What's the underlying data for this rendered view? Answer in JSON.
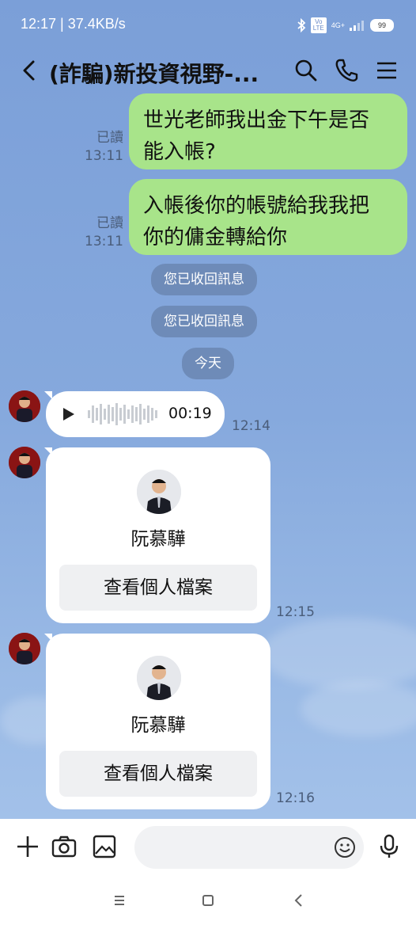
{
  "status": {
    "time_speed": "12:17 | 37.4KB/s",
    "volte": "Vo LTE",
    "network": "4G+",
    "battery": "99"
  },
  "header": {
    "title": "(詐騙)新投資視野-...",
    "back_icon": "back-arrow-icon",
    "search_icon": "search-icon",
    "call_icon": "phone-icon",
    "menu_icon": "menu-icon"
  },
  "messages": [
    {
      "type": "outgoing",
      "text_line1": "世光老師我出金下午是否",
      "text_line2": "能入帳?",
      "read": "已讀",
      "time": "13:11"
    },
    {
      "type": "outgoing",
      "text_line1": "入帳後你的帳號給我我把",
      "text_line2": "你的傭金轉給你",
      "read": "已讀",
      "time": "13:11"
    }
  ],
  "system": {
    "recalled1": "您已收回訊息",
    "recalled2": "您已收回訊息",
    "date": "今天"
  },
  "voice": {
    "duration": "00:19",
    "time": "12:14"
  },
  "cards": [
    {
      "name": "阮慕驊",
      "button": "查看個人檔案",
      "time": "12:15"
    },
    {
      "name": "阮慕驊",
      "button": "查看個人檔案",
      "time": "12:16"
    }
  ],
  "input": {
    "placeholder": ""
  },
  "colors": {
    "bubble_out": "#a8e48a",
    "chat_bg": "#86a9dd",
    "system_pill": "#6e8bb8"
  }
}
